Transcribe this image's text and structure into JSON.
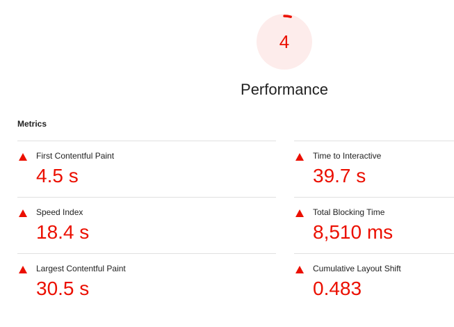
{
  "gauge": {
    "score": "4",
    "score_fraction": 0.04,
    "title": "Performance",
    "fail_color": "#eb0f00",
    "fail_bg": "#fdeceb"
  },
  "metrics": {
    "heading": "Metrics",
    "status_icon": "fail-triangle-icon",
    "left": [
      {
        "title": "First Contentful Paint",
        "value": "4.5 s"
      },
      {
        "title": "Speed Index",
        "value": "18.4 s"
      },
      {
        "title": "Largest Contentful Paint",
        "value": "30.5 s"
      }
    ],
    "right": [
      {
        "title": "Time to Interactive",
        "value": "39.7 s"
      },
      {
        "title": "Total Blocking Time",
        "value": "8,510 ms"
      },
      {
        "title": "Cumulative Layout Shift",
        "value": "0.483"
      }
    ]
  }
}
